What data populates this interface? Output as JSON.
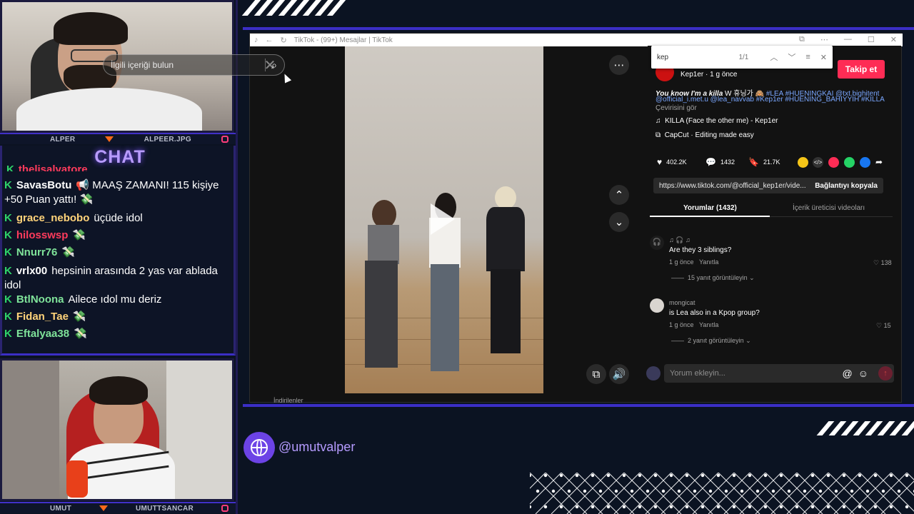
{
  "streamer_top": {
    "left_label": "ALPER",
    "right_label": "ALPEER.JPG"
  },
  "streamer_bottom": {
    "left_label": "UMUT",
    "right_label": "UMUTTSANCAR"
  },
  "chat": {
    "title": "CHAT",
    "partial_top": "thelisalvatore",
    "messages": [
      {
        "user": "SavasBotu",
        "color": "#ffffff",
        "text": "📢 MAAŞ ZAMANI! 115 kişiye +50 Puan yattı! 💸"
      },
      {
        "user": "grace_nebobo",
        "color": "#ffd37a",
        "text": "üçüde idol"
      },
      {
        "user": "hilosswsp",
        "color": "#ff3b5c",
        "text": ""
      },
      {
        "user": "Nnurr76",
        "color": "#7fe39a",
        "text": ""
      },
      {
        "user": "vrlx00",
        "color": "#ffffff",
        "text": "hepsinin arasında 2 yas var ablada idol"
      },
      {
        "user": "BtlNoona",
        "color": "#7fe39a",
        "text": "Ailece ıdol mu deriz"
      },
      {
        "user": "Fidan_Tae",
        "color": "#ffd37a",
        "text": ""
      },
      {
        "user": "Eftalyaa38",
        "color": "#7fe39a",
        "text": ""
      }
    ]
  },
  "browser": {
    "tab_title": "TikTok - (99+) Mesajlar | TikTok",
    "find_query": "kep",
    "find_count": "1/1"
  },
  "video": {
    "search_placeholder": "İlgili içeriği bulun"
  },
  "post": {
    "author": "Kep1er · 1 g önce",
    "follow_label": "Takip et",
    "caption_lead": "You know I'm a killa",
    "caption_rest": "W 휴닝가 🙈 ",
    "hashtags_line1": "#LEA #HUENINGKAI @txt.bighitent",
    "hashtags_line2": "@official_i.met.u @lea_navvab #Kep1er #HUENING_BAHIYYIH #KILLA",
    "translate": "Çevirisini gör",
    "music": "KILLA (Face the other me) - Kep1er",
    "capcut": "CapCut · Editing made easy",
    "likes": "402.2K",
    "comments": "1432",
    "saves": "21.7K",
    "link": "https://www.tiktok.com/@official_kep1er/vide...",
    "copy_label": "Bağlantıyı kopyala",
    "tab_comments": "Yorumlar (1432)",
    "tab_creator": "İçerik üreticisi videoları"
  },
  "comments": [
    {
      "user": "♫ 🎧 ♫",
      "text": "Are they 3 siblings?",
      "time": "1 g önce",
      "reply": "Yanıtla",
      "likes": "138",
      "more": "15 yanıt görüntüleyin"
    },
    {
      "user": "mongicat",
      "text": "is Lea also in a Kpop group?",
      "time": "1 g önce",
      "reply": "Yanıtla",
      "likes": "15",
      "more": "2 yanıt görüntüleyin"
    }
  ],
  "comment_input_placeholder": "Yorum ekleyin...",
  "downloads_label": "İndirilenler",
  "handle": "@umutvalper"
}
